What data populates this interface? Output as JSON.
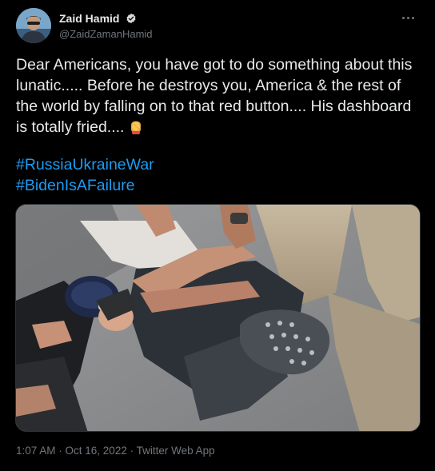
{
  "author": {
    "display_name": "Zaid Hamid",
    "handle": "@ZaidZamanHamid",
    "verified": true
  },
  "tweet": {
    "text": "Dear Americans, you have got to do something about this lunatic..... Before he destroys you, America & the rest of the world by falling on to that red button.... His dashboard is totally fried....",
    "emoji": "woman-facepalming-emoji",
    "hashtags": [
      "#RussiaUkraineWar",
      "#BidenIsAFailure"
    ]
  },
  "media": {
    "type": "photo"
  },
  "meta": {
    "time": "1:07 AM",
    "separator1": " · ",
    "date": "Oct 16, 2022",
    "separator2": " · ",
    "source": "Twitter Web App"
  },
  "colors": {
    "background": "#000000",
    "text": "#e7e9ea",
    "secondary": "#71767b",
    "link": "#1d9bf0",
    "verified": "#d9d9d9"
  }
}
